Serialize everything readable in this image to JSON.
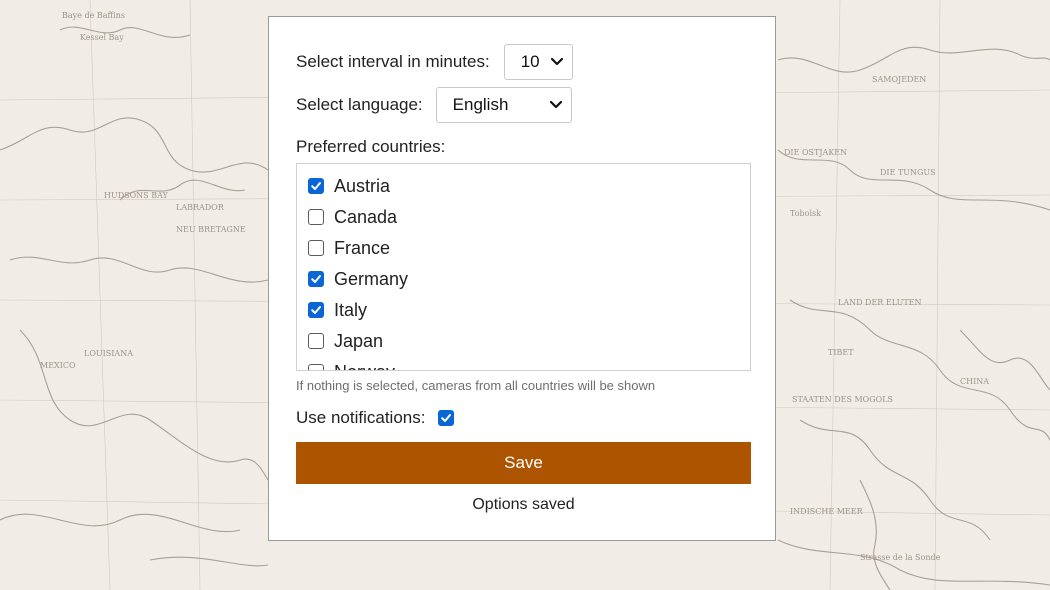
{
  "options": {
    "interval_label": "Select interval in minutes:",
    "interval_value": "10",
    "language_label": "Select language:",
    "language_value": "English",
    "countries_label": "Preferred countries:",
    "countries": [
      {
        "name": "Austria",
        "checked": true
      },
      {
        "name": "Canada",
        "checked": false
      },
      {
        "name": "France",
        "checked": false
      },
      {
        "name": "Germany",
        "checked": true
      },
      {
        "name": "Italy",
        "checked": true
      },
      {
        "name": "Japan",
        "checked": false
      },
      {
        "name": "Norway",
        "checked": false
      }
    ],
    "countries_hint": "If nothing is selected, cameras from all countries will be shown",
    "notifications_label": "Use notifications:",
    "notifications_checked": true,
    "save_label": "Save",
    "status_text": "Options saved"
  },
  "colors": {
    "accent": "#ad5400",
    "checkbox": "#0a66d6",
    "background": "#f1ede6"
  },
  "background_image": {
    "map_labels": [
      "Baye de Baffins",
      "Kessel Bay",
      "HUDSONS BAY",
      "LABRADOR",
      "NEU BRETAGNE",
      "MEXICO",
      "LOUISIANA",
      "SAMOJEDEN",
      "DIE OSTJAKEN",
      "DIE TUNGUS",
      "Tobolsk",
      "LAND DER ELUTEN",
      "TIBET",
      "CHINA",
      "STAATEN DES MOGOLS",
      "Strasse de la Sonde",
      "INDISCHE MEER"
    ]
  }
}
